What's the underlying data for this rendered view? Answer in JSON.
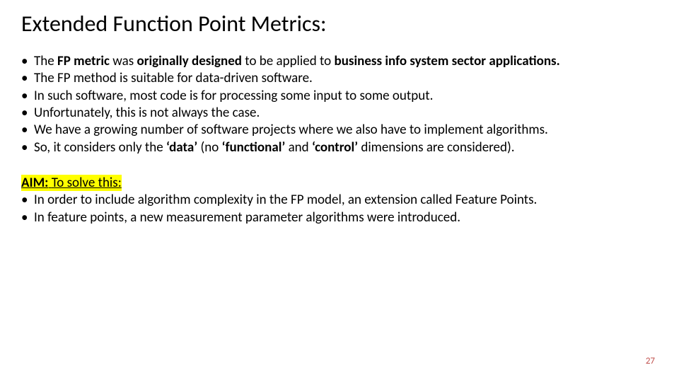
{
  "title": "Extended Function Point Metrics:",
  "bullets": [
    "The <b>FP metric</b> was <b>originally designed</b> to be applied to <b>business info system sector applications.</b>",
    "The FP method is suitable for data-driven software.",
    "In such software, most code is for processing some input to some output.",
    "Unfortunately, this is not always the case.",
    "We have a growing number of software projects where we also have to implement algorithms.",
    "So, it considers only the <b>‘data’</b> (no <b>‘functional’</b> and <b>‘control’</b> dimensions are considered)."
  ],
  "aim": {
    "label": "AIM:",
    "subtitle": "To solve this:",
    "items": [
      " In order to include algorithm complexity in the FP model, an extension called Feature Points.",
      "In feature points, a new measurement parameter algorithms were introduced."
    ]
  },
  "page_number": "27"
}
